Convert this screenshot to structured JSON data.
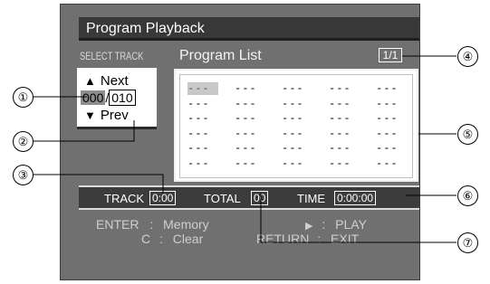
{
  "title": "Program Playback",
  "select_track": "SELECT TRACK",
  "program_list_label": "Program List",
  "page_indicator": "1/1",
  "track_selector": {
    "next_label": "Next",
    "prev_label": "Prev",
    "up_arrow": "▲",
    "down_arrow": "▼",
    "current": "000",
    "separator": "/",
    "total": "010"
  },
  "program_list": {
    "rows": [
      [
        "---",
        "---",
        "---",
        "---",
        "---"
      ],
      [
        "---",
        "---",
        "---",
        "---",
        "---"
      ],
      [
        "---",
        "---",
        "---",
        "---",
        "---"
      ],
      [
        "---",
        "---",
        "---",
        "---",
        "---"
      ],
      [
        "---",
        "---",
        "---",
        "---",
        "---"
      ],
      [
        "---",
        "---",
        "---",
        "---",
        "---"
      ]
    ]
  },
  "status": {
    "track_label": "TRACK",
    "track_value": "0:00",
    "total_label": "TOTAL",
    "total_value": "00",
    "time_label": "TIME",
    "time_value": "0:00:00"
  },
  "help": {
    "enter_key": "ENTER",
    "enter_action": "Memory",
    "c_key": "C",
    "c_action": "Clear",
    "play_key": "▶",
    "play_action": "PLAY",
    "return_key": "RETURN",
    "return_action": "EXIT",
    "colon": ":"
  },
  "callouts": [
    "①",
    "②",
    "③",
    "④",
    "⑤",
    "⑥",
    "⑦"
  ]
}
